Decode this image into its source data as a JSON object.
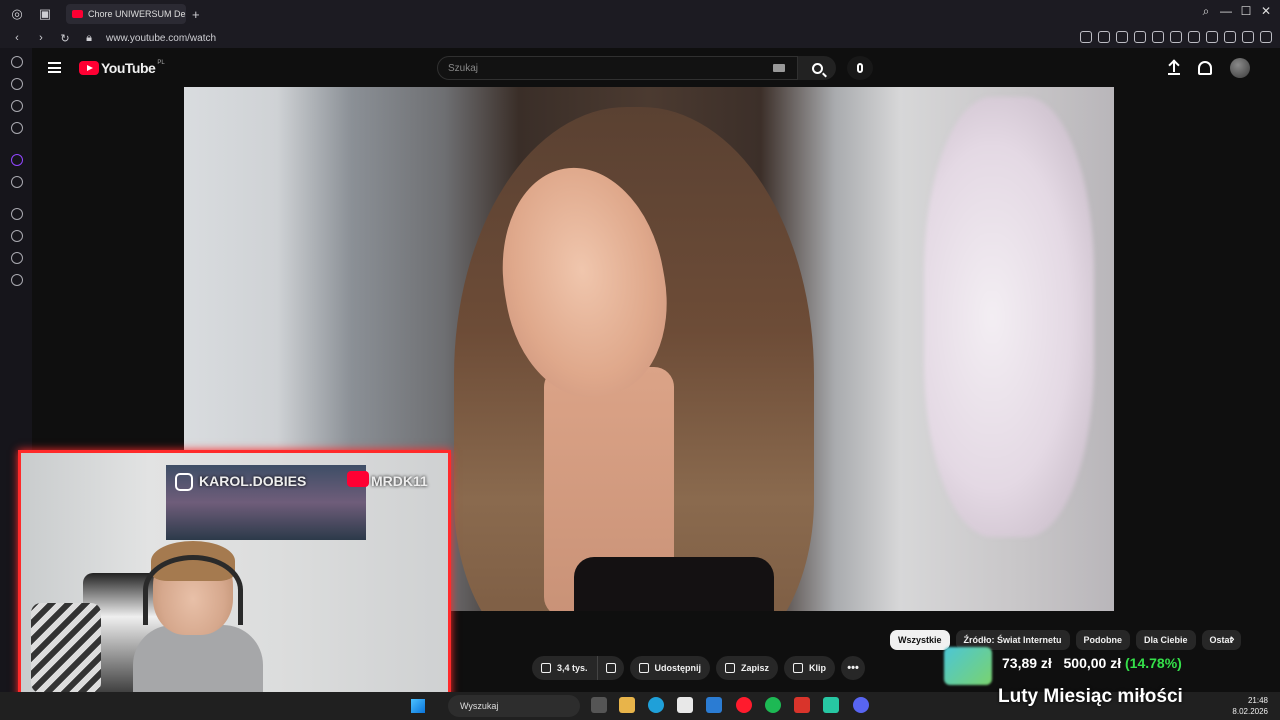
{
  "browser": {
    "tab_title": "Chore UNIWERSUM Denis",
    "url": "www.youtube.com/watch"
  },
  "youtube": {
    "logo_text": "YouTube",
    "country_code": "PL",
    "search_placeholder": "Szukaj",
    "actions": {
      "likes": "3,4 tys.",
      "share": "Udostępnij",
      "save": "Zapisz",
      "clip": "Klip",
      "more": "•••"
    },
    "chips": [
      "Wszystkie",
      "Źródło: Świat Internetu",
      "Podobne",
      "Dla Ciebie",
      "Ostat"
    ]
  },
  "stream_overlay": {
    "instagram_handle": "KAROL.DOBIES",
    "youtube_handle": "MRDK11",
    "donation": {
      "current": "73,89 zł",
      "goal": "500,00 zł",
      "percent": "(14.78%)",
      "title": "Luty Miesiąc miłości"
    }
  },
  "taskbar": {
    "search_label": "Wyszukaj",
    "time": "21:48",
    "date": "8.02.2026"
  },
  "colors": {
    "overlay_border": "#ff2a2a",
    "youtube_red": "#ff0033",
    "donation_percent": "#35e04a"
  }
}
